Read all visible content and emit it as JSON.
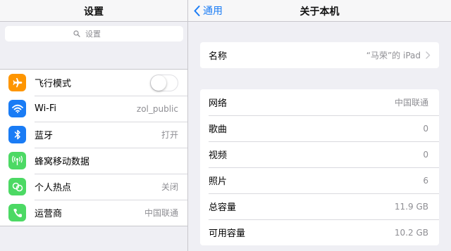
{
  "left_panel": {
    "title": "设置",
    "search_placeholder": "设置",
    "items": [
      {
        "label": "飞行模式",
        "icon": "airplane-icon",
        "color": "#fe9500",
        "toggle": false
      },
      {
        "label": "Wi-Fi",
        "icon": "wifi-icon",
        "color": "#1a7cf5",
        "value": "zol_public"
      },
      {
        "label": "蓝牙",
        "icon": "bluetooth-icon",
        "color": "#1a7cf5",
        "value": "打开"
      },
      {
        "label": "蜂窝移动数据",
        "icon": "cellular-icon",
        "color": "#4cd964",
        "value": ""
      },
      {
        "label": "个人热点",
        "icon": "hotspot-icon",
        "color": "#4cd964",
        "value": "关闭"
      },
      {
        "label": "运营商",
        "icon": "phone-icon",
        "color": "#4cd964",
        "value": "中国联通"
      }
    ]
  },
  "right_panel": {
    "back_label": "通用",
    "title": "关于本机",
    "name_row": {
      "label": "名称",
      "value": "“马荣”的 iPad"
    },
    "info_rows": [
      {
        "label": "网络",
        "value": "中国联通"
      },
      {
        "label": "歌曲",
        "value": "0"
      },
      {
        "label": "视频",
        "value": "0"
      },
      {
        "label": "照片",
        "value": "6"
      },
      {
        "label": "总容量",
        "value": "11.9 GB"
      },
      {
        "label": "可用容量",
        "value": "10.2 GB"
      }
    ]
  },
  "colors": {
    "accent": "#1a7cf5",
    "orange": "#fe9500",
    "green": "#4cd964"
  }
}
